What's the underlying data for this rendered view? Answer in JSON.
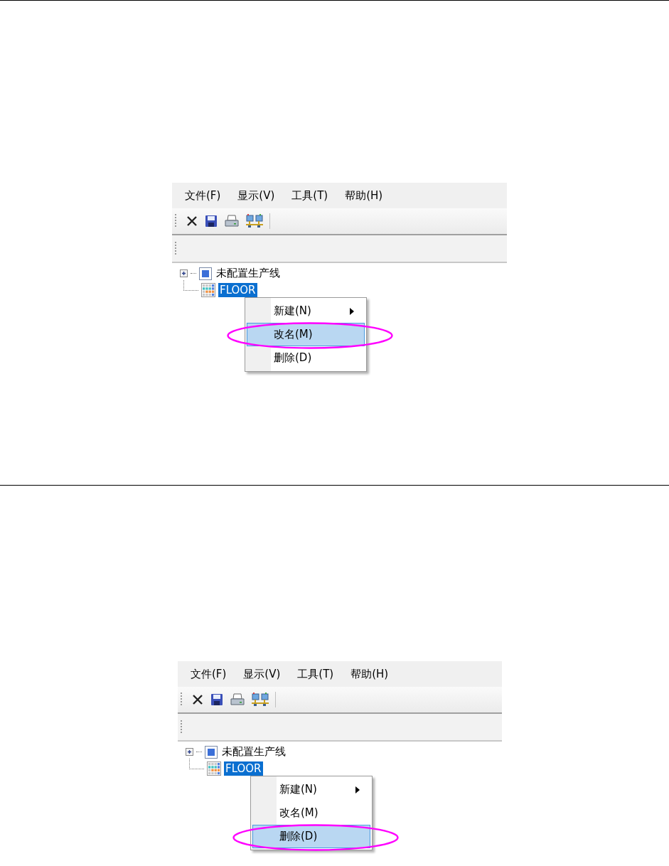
{
  "figures": [
    {
      "menu_bar": [
        "文件(F)",
        "显示(V)",
        "工具(T)",
        "帮助(H)"
      ],
      "tree": [
        {
          "label": "未配置生产线",
          "kind": "line",
          "selected": false
        },
        {
          "label": "FLOOR",
          "kind": "floor",
          "selected": true
        }
      ],
      "context_menu": [
        {
          "label": "新建(N)",
          "submenu": true,
          "selected": false,
          "circled": false
        },
        {
          "label": "改名(M)",
          "submenu": false,
          "selected": true,
          "circled": true
        },
        {
          "label": "删除(D)",
          "submenu": false,
          "selected": false,
          "circled": false
        }
      ]
    },
    {
      "menu_bar": [
        "文件(F)",
        "显示(V)",
        "工具(T)",
        "帮助(H)"
      ],
      "tree": [
        {
          "label": "未配置生产线",
          "kind": "line",
          "selected": false
        },
        {
          "label": "FLOOR",
          "kind": "floor",
          "selected": true
        }
      ],
      "context_menu": [
        {
          "label": "新建(N)",
          "submenu": true,
          "selected": false,
          "circled": false
        },
        {
          "label": "改名(M)",
          "submenu": false,
          "selected": false,
          "circled": false
        },
        {
          "label": "删除(D)",
          "submenu": false,
          "selected": true,
          "circled": true
        }
      ]
    }
  ]
}
